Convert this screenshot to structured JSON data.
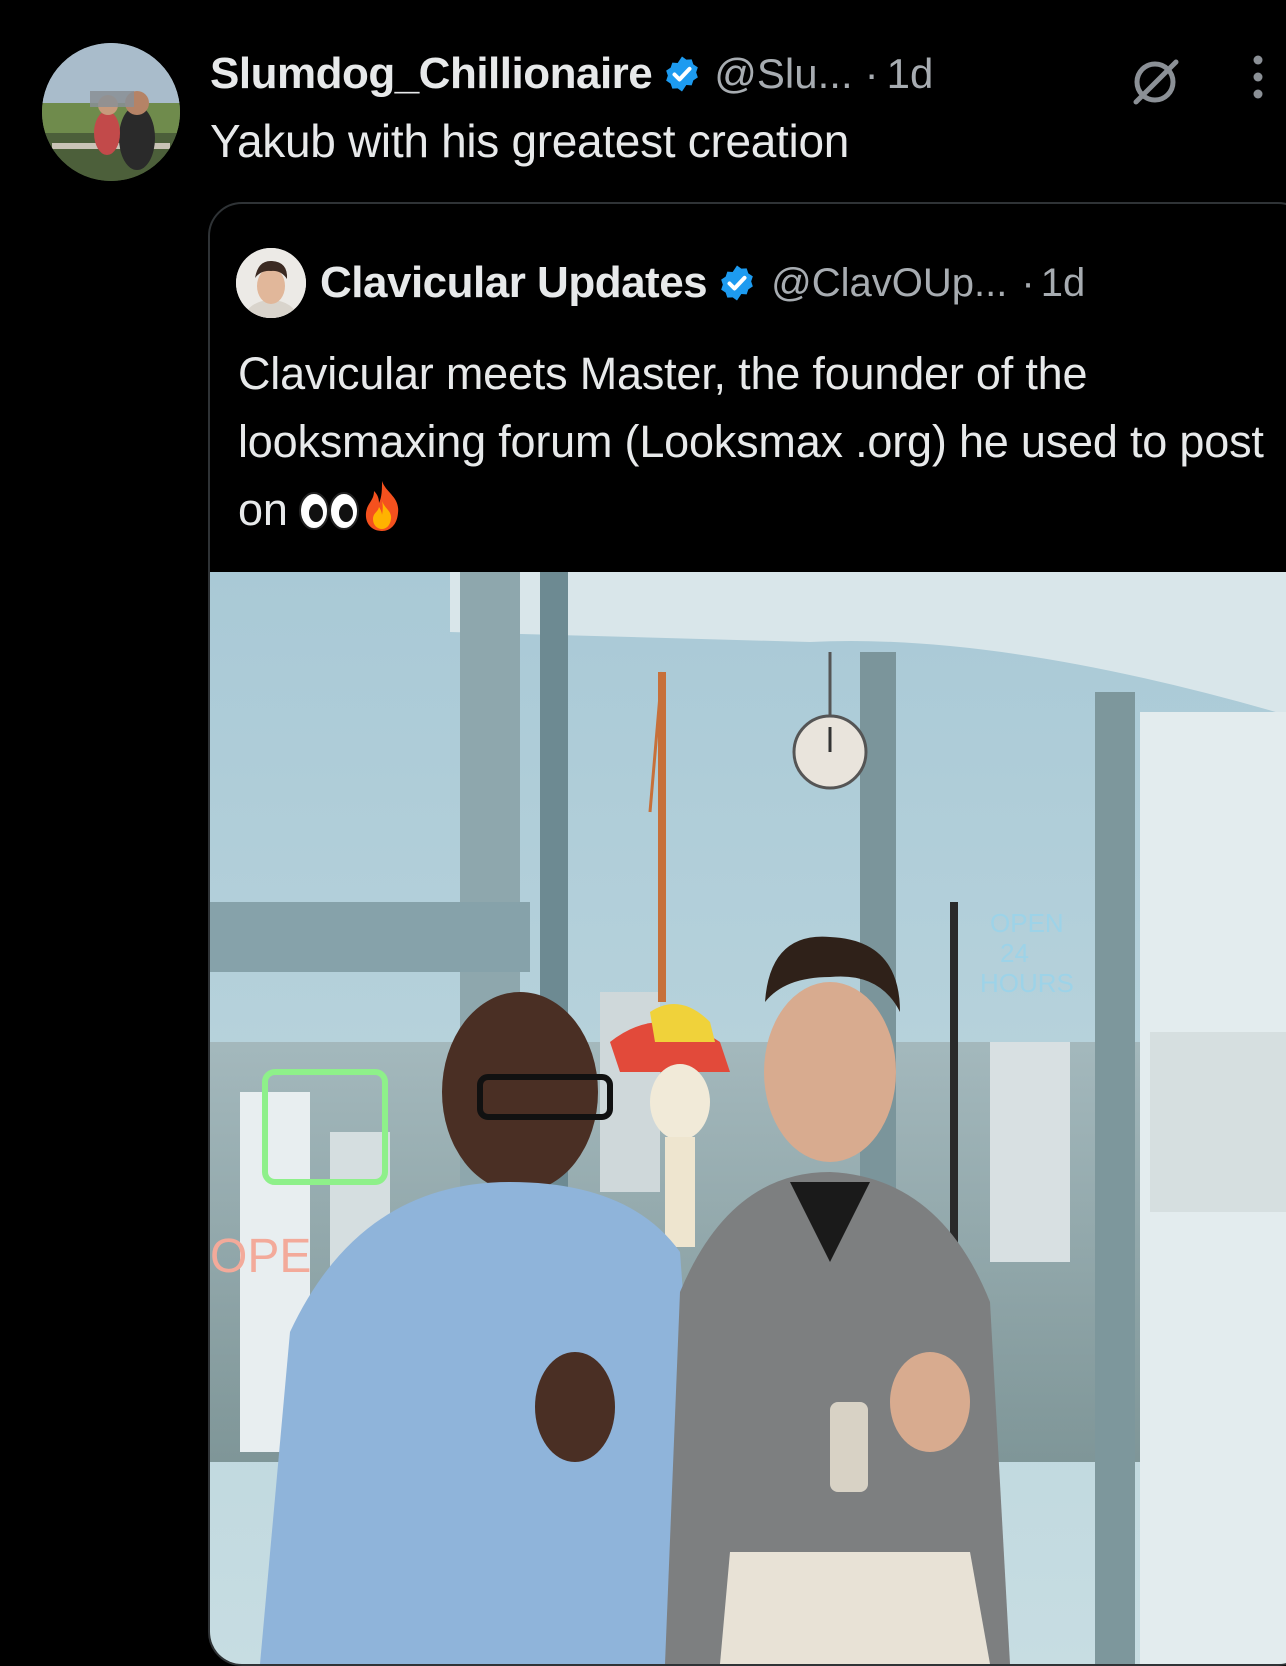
{
  "post": {
    "display_name": "Slumdog_Chillionaire",
    "handle": "@Slu...",
    "separator": "·",
    "time": "1d",
    "text": "Yakub with his greatest creation",
    "avatar_icon": "profile-photo",
    "verified_icon": "verified-badge-icon",
    "actions": [
      "grok-icon",
      "more-options-icon"
    ]
  },
  "quote": {
    "display_name": "Clavicular Updates",
    "handle": "@ClavOUp...",
    "separator": "·",
    "time": "1d",
    "text": "Clavicular meets Master, the founder of the looksmaxing forum (Looksmax .org) he used to post on",
    "emojis": [
      "eyes-emoji",
      "fire-emoji"
    ],
    "photo": {
      "sign_text": "OPEN 24 HOURS",
      "neon_sign": "OPE"
    }
  },
  "colors": {
    "background": "#000000",
    "text_primary": "#e7e9ea",
    "text_secondary": "#a7acb1",
    "verified_blue": "#1d9bf0",
    "card_border": "#2f3336"
  }
}
